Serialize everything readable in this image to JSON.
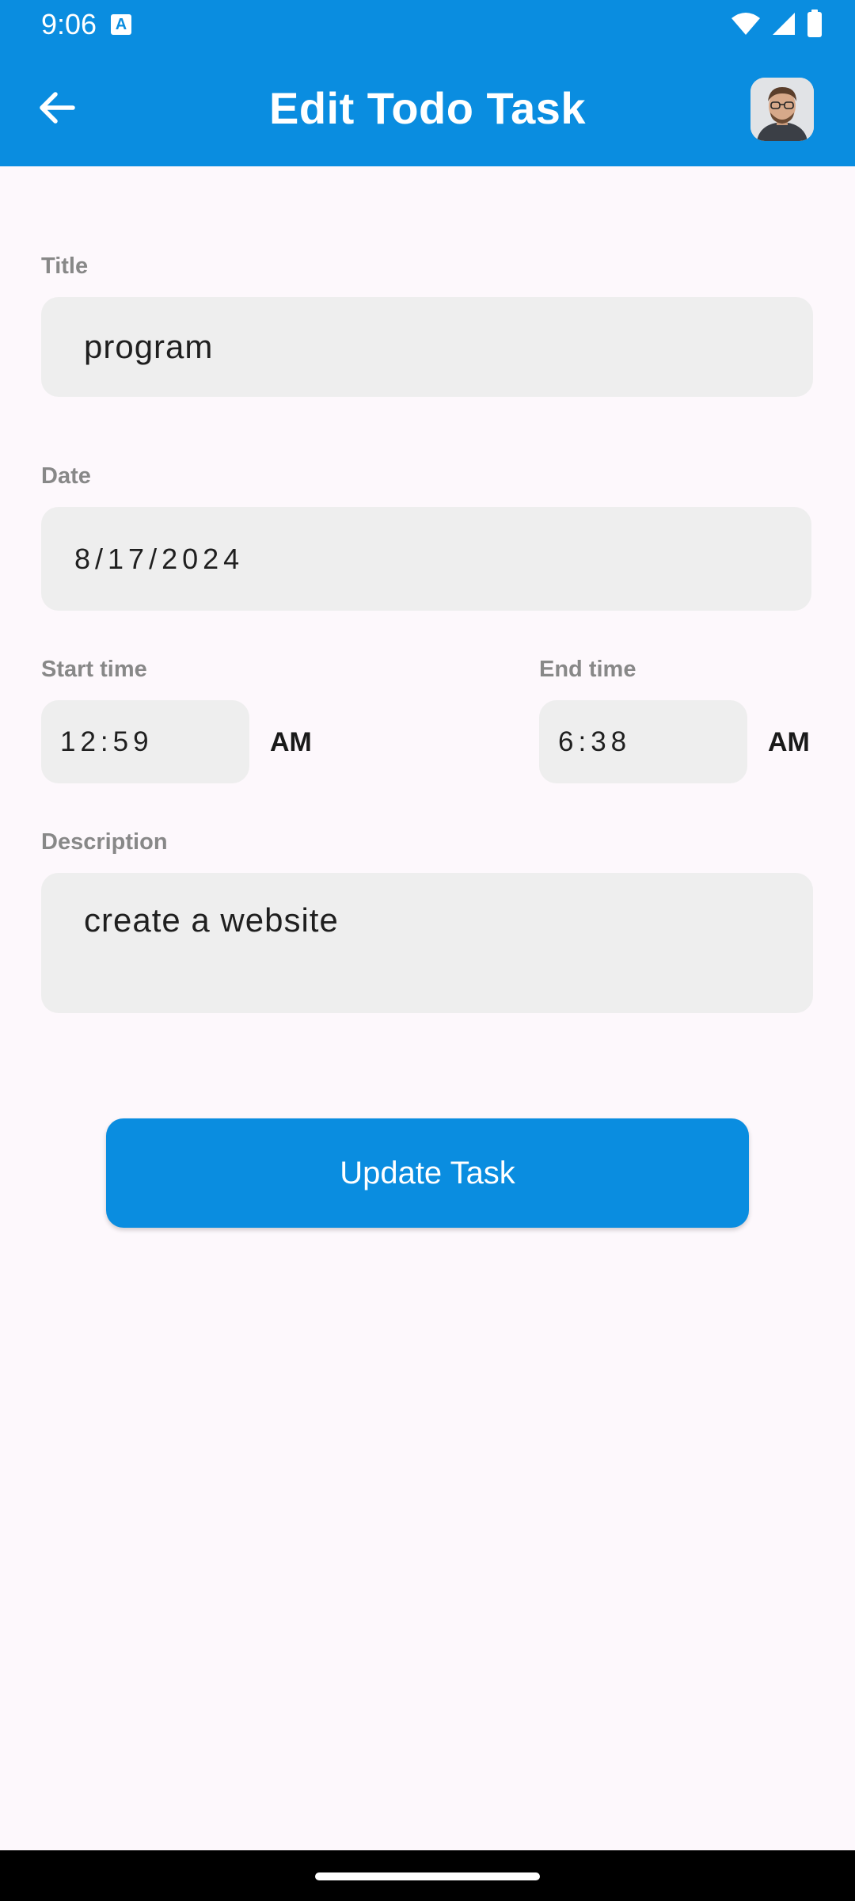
{
  "status_bar": {
    "time": "9:06",
    "icons": [
      "keyboard-a-icon",
      "wifi-icon",
      "signal-icon",
      "battery-icon"
    ]
  },
  "app_bar": {
    "title": "Edit Todo Task",
    "back_icon": "arrow-left-icon",
    "avatar_icon": "user-avatar"
  },
  "form": {
    "title": {
      "label": "Title",
      "value": "program"
    },
    "date": {
      "label": "Date",
      "value": "8/17/2024"
    },
    "start_time": {
      "label": "Start time",
      "value": "12:59",
      "period": "AM"
    },
    "end_time": {
      "label": "End time",
      "value": "6:38",
      "period": "AM"
    },
    "description": {
      "label": "Description",
      "value": "create a website"
    }
  },
  "actions": {
    "update_label": "Update Task"
  },
  "colors": {
    "primary": "#0a8de0",
    "background": "#fdf8fc",
    "field_bg": "#eeeeee",
    "label": "#888888"
  }
}
